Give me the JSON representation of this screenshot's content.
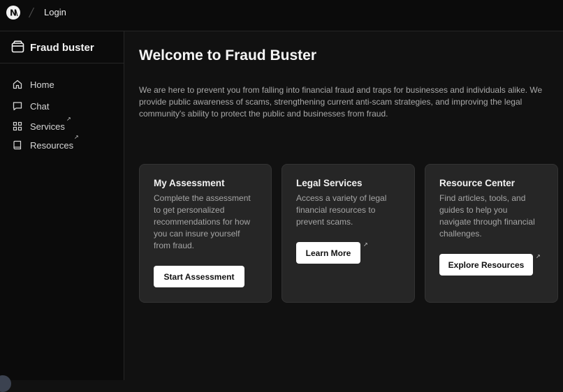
{
  "topbar": {
    "logo_letter": "N",
    "breadcrumb": "Login"
  },
  "sidebar": {
    "brand": "Fraud buster",
    "items": [
      {
        "label": "Home",
        "icon": "home-icon"
      },
      {
        "label": "Chat",
        "icon": "chat-icon"
      },
      {
        "label": "Services",
        "icon": "grid-icon",
        "external": "↗"
      },
      {
        "label": "Resources",
        "icon": "book-icon",
        "external": "↗"
      }
    ]
  },
  "main": {
    "title": "Welcome to Fraud Buster",
    "intro": "We are here to prevent you from falling into financial fraud and traps for businesses and individuals alike. We provide public awareness of scams, strengthening current anti-scam strategies, and improving the legal community's ability to protect the public and businesses from fraud.",
    "cards": [
      {
        "title": "My Assessment",
        "description_lines": [
          "Complete the assessment",
          "to get personalized",
          "recommendations for how",
          "you can insure yourself",
          "from fraud."
        ],
        "button": "Start Assessment"
      },
      {
        "title": "Legal Services",
        "description_lines": [
          "Access a variety of legal",
          "financial resources to",
          "prevent scams."
        ],
        "button": "Learn More",
        "external": "↗"
      },
      {
        "title": "Resource Center",
        "description_lines": [
          "Find articles, tools, and",
          "guides to help you",
          "navigate through financial",
          "challenges."
        ],
        "button": "Explore Resources",
        "external": "↗"
      }
    ]
  },
  "colors": {
    "background": "#111111",
    "sidebar": "#0b0b0b",
    "card": "#262626",
    "button": "#ffffff"
  }
}
